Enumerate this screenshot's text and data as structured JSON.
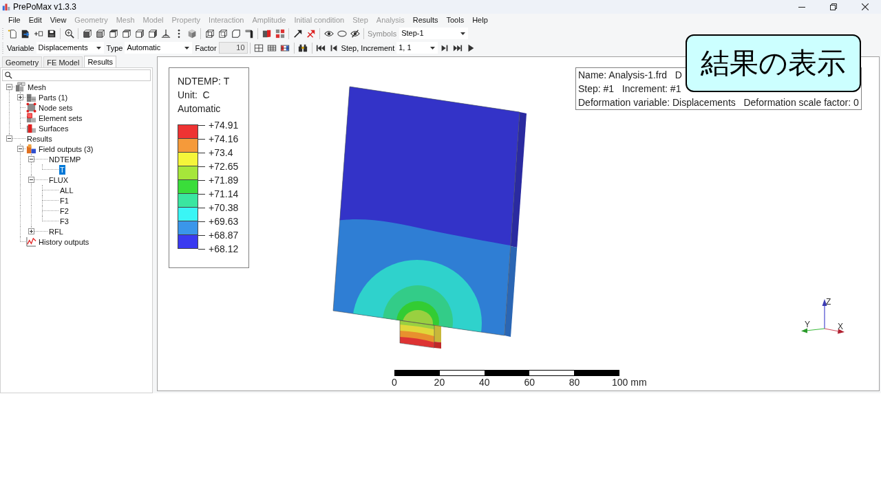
{
  "window": {
    "title": "PrePoMax v1.3.3"
  },
  "menu": [
    {
      "label": "File",
      "disabled": false
    },
    {
      "label": "Edit",
      "disabled": false
    },
    {
      "label": "View",
      "disabled": false
    },
    {
      "label": "Geometry",
      "disabled": true
    },
    {
      "label": "Mesh",
      "disabled": true
    },
    {
      "label": "Model",
      "disabled": true
    },
    {
      "label": "Property",
      "disabled": true
    },
    {
      "label": "Interaction",
      "disabled": true
    },
    {
      "label": "Amplitude",
      "disabled": true
    },
    {
      "label": "Initial condition",
      "disabled": true
    },
    {
      "label": "Step",
      "disabled": true
    },
    {
      "label": "Analysis",
      "disabled": true
    },
    {
      "label": "Results",
      "disabled": false
    },
    {
      "label": "Tools",
      "disabled": false
    },
    {
      "label": "Help",
      "disabled": false
    }
  ],
  "view_toolbar": {
    "symbols": {
      "label": "Symbols",
      "value": "Step-1",
      "disabled": true
    }
  },
  "results_toolbar": {
    "variable": {
      "label": "Variable",
      "value": "Displacements"
    },
    "type": {
      "label": "Type",
      "value": "Automatic"
    },
    "factor": {
      "label": "Factor",
      "value": "10",
      "disabled": true
    },
    "step_increment": {
      "label": "Step, Increment",
      "value": "1, 1"
    }
  },
  "tabs": [
    {
      "label": "Geometry",
      "selected": false
    },
    {
      "label": "FE Model",
      "selected": false
    },
    {
      "label": "Results",
      "selected": true
    }
  ],
  "tree": [
    {
      "label": "Mesh",
      "kind": "branch",
      "expanded": true,
      "selected": false,
      "children": [
        {
          "label": "Parts (1)",
          "kind": "branch",
          "expanded": false,
          "selected": false
        },
        {
          "label": "Node sets",
          "kind": "leaf",
          "selected": false
        },
        {
          "label": "Element sets",
          "kind": "leaf",
          "selected": false
        },
        {
          "label": "Surfaces",
          "kind": "leaf",
          "selected": false
        }
      ]
    },
    {
      "label": "Results",
      "kind": "branch",
      "expanded": true,
      "selected": false,
      "children": [
        {
          "label": "Field outputs (3)",
          "kind": "branch",
          "expanded": true,
          "selected": false,
          "children": [
            {
              "label": "NDTEMP",
              "kind": "branch",
              "expanded": true,
              "selected": false,
              "children": [
                {
                  "label": "T",
                  "kind": "leaf",
                  "selected": true
                }
              ]
            },
            {
              "label": "FLUX",
              "kind": "branch",
              "expanded": true,
              "selected": false,
              "children": [
                {
                  "label": "ALL",
                  "kind": "leaf",
                  "selected": false
                },
                {
                  "label": "F1",
                  "kind": "leaf",
                  "selected": false
                },
                {
                  "label": "F2",
                  "kind": "leaf",
                  "selected": false
                },
                {
                  "label": "F3",
                  "kind": "leaf",
                  "selected": false
                }
              ]
            },
            {
              "label": "RFL",
              "kind": "branch",
              "expanded": false,
              "selected": false
            }
          ]
        },
        {
          "label": "History outputs",
          "kind": "leaf",
          "selected": false
        }
      ]
    }
  ],
  "legend": {
    "title": "NDTEMP: T",
    "unit": "Unit:  C",
    "mode": "Automatic",
    "bands": [
      {
        "color": "#ee3333"
      },
      {
        "color": "#f59a3a"
      },
      {
        "color": "#f5f53a"
      },
      {
        "color": "#a6e63a"
      },
      {
        "color": "#3add3a"
      },
      {
        "color": "#3ae6a0"
      },
      {
        "color": "#3af5f5"
      },
      {
        "color": "#3a96ea"
      },
      {
        "color": "#3a3af0"
      }
    ],
    "labels": [
      "+74.91",
      "+74.16",
      "+73.4",
      "+72.65",
      "+71.89",
      "+71.14",
      "+70.38",
      "+69.63",
      "+68.87",
      "+68.12"
    ]
  },
  "info": {
    "lines": [
      "Name: Analysis-1.frd   D",
      "Step: #1   Increment: #1",
      "Deformation variable: Displacements   Deformation scale factor: 0"
    ]
  },
  "scale_bar": {
    "labels": [
      "0",
      "20",
      "40",
      "60",
      "80",
      "100 mm"
    ]
  },
  "axes": [
    {
      "label": "Z"
    },
    {
      "label": "Y"
    },
    {
      "label": "X"
    }
  ],
  "callout": {
    "text": "結果の表示"
  }
}
